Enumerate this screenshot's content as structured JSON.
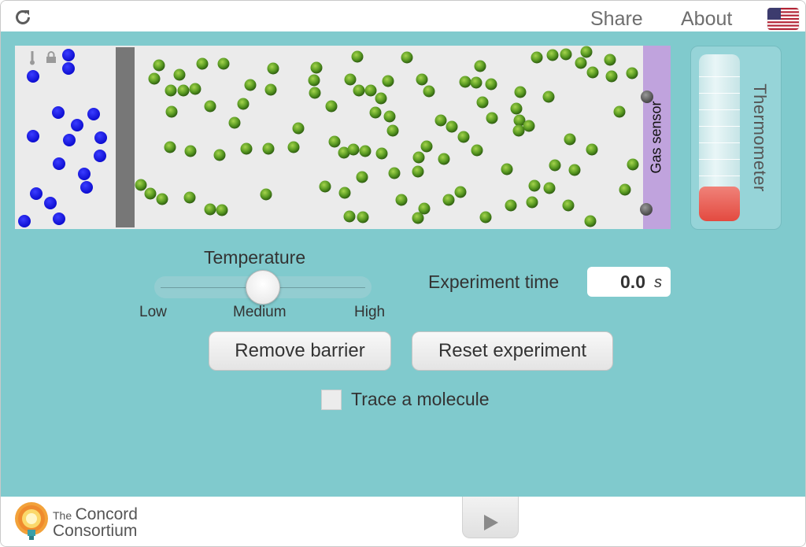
{
  "topbar": {
    "reload_icon": "reload-icon",
    "share_label": "Share",
    "about_label": "About",
    "language_icon": "us-flag-icon"
  },
  "simulation": {
    "barrier_icon": "barrier",
    "lock_icon": "lock-icon",
    "thermometer_small_icon": "thermometer-icon",
    "molecule_colors": {
      "blue": "#0f10e0",
      "green": "#4f8f22"
    },
    "sensor_label": "Gas sensor",
    "sensor_color": "#c0a3dd"
  },
  "thermometer": {
    "label": "Thermometer",
    "level": 0.19
  },
  "temperature_slider": {
    "title": "Temperature",
    "low_label": "Low",
    "medium_label": "Medium",
    "high_label": "High",
    "value": "Medium"
  },
  "experiment_time": {
    "label": "Experiment time",
    "value": "0.0",
    "unit": "s"
  },
  "buttons": {
    "remove_barrier": "Remove barrier",
    "reset_experiment": "Reset experiment"
  },
  "trace": {
    "label": "Trace a molecule",
    "checked": false
  },
  "footer": {
    "logo_the": "The",
    "logo_concord": "Concord",
    "logo_consortium": "Consortium",
    "play_icon": "play-icon"
  },
  "theme": {
    "panel_bg": "#80cacd",
    "thermo_fill": "#e34a40"
  }
}
